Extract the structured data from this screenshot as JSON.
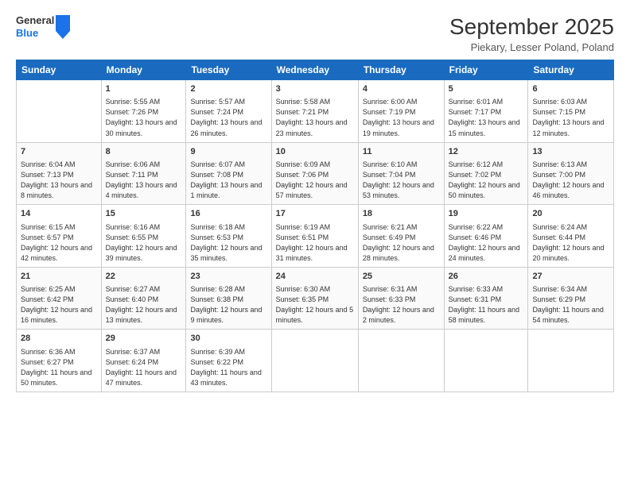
{
  "logo": {
    "general": "General",
    "blue": "Blue"
  },
  "title": "September 2025",
  "location": "Piekary, Lesser Poland, Poland",
  "days_of_week": [
    "Sunday",
    "Monday",
    "Tuesday",
    "Wednesday",
    "Thursday",
    "Friday",
    "Saturday"
  ],
  "weeks": [
    [
      {
        "day": "",
        "sunrise": "",
        "sunset": "",
        "daylight": ""
      },
      {
        "day": "1",
        "sunrise": "Sunrise: 5:55 AM",
        "sunset": "Sunset: 7:26 PM",
        "daylight": "Daylight: 13 hours and 30 minutes."
      },
      {
        "day": "2",
        "sunrise": "Sunrise: 5:57 AM",
        "sunset": "Sunset: 7:24 PM",
        "daylight": "Daylight: 13 hours and 26 minutes."
      },
      {
        "day": "3",
        "sunrise": "Sunrise: 5:58 AM",
        "sunset": "Sunset: 7:21 PM",
        "daylight": "Daylight: 13 hours and 23 minutes."
      },
      {
        "day": "4",
        "sunrise": "Sunrise: 6:00 AM",
        "sunset": "Sunset: 7:19 PM",
        "daylight": "Daylight: 13 hours and 19 minutes."
      },
      {
        "day": "5",
        "sunrise": "Sunrise: 6:01 AM",
        "sunset": "Sunset: 7:17 PM",
        "daylight": "Daylight: 13 hours and 15 minutes."
      },
      {
        "day": "6",
        "sunrise": "Sunrise: 6:03 AM",
        "sunset": "Sunset: 7:15 PM",
        "daylight": "Daylight: 13 hours and 12 minutes."
      }
    ],
    [
      {
        "day": "7",
        "sunrise": "Sunrise: 6:04 AM",
        "sunset": "Sunset: 7:13 PM",
        "daylight": "Daylight: 13 hours and 8 minutes."
      },
      {
        "day": "8",
        "sunrise": "Sunrise: 6:06 AM",
        "sunset": "Sunset: 7:11 PM",
        "daylight": "Daylight: 13 hours and 4 minutes."
      },
      {
        "day": "9",
        "sunrise": "Sunrise: 6:07 AM",
        "sunset": "Sunset: 7:08 PM",
        "daylight": "Daylight: 13 hours and 1 minute."
      },
      {
        "day": "10",
        "sunrise": "Sunrise: 6:09 AM",
        "sunset": "Sunset: 7:06 PM",
        "daylight": "Daylight: 12 hours and 57 minutes."
      },
      {
        "day": "11",
        "sunrise": "Sunrise: 6:10 AM",
        "sunset": "Sunset: 7:04 PM",
        "daylight": "Daylight: 12 hours and 53 minutes."
      },
      {
        "day": "12",
        "sunrise": "Sunrise: 6:12 AM",
        "sunset": "Sunset: 7:02 PM",
        "daylight": "Daylight: 12 hours and 50 minutes."
      },
      {
        "day": "13",
        "sunrise": "Sunrise: 6:13 AM",
        "sunset": "Sunset: 7:00 PM",
        "daylight": "Daylight: 12 hours and 46 minutes."
      }
    ],
    [
      {
        "day": "14",
        "sunrise": "Sunrise: 6:15 AM",
        "sunset": "Sunset: 6:57 PM",
        "daylight": "Daylight: 12 hours and 42 minutes."
      },
      {
        "day": "15",
        "sunrise": "Sunrise: 6:16 AM",
        "sunset": "Sunset: 6:55 PM",
        "daylight": "Daylight: 12 hours and 39 minutes."
      },
      {
        "day": "16",
        "sunrise": "Sunrise: 6:18 AM",
        "sunset": "Sunset: 6:53 PM",
        "daylight": "Daylight: 12 hours and 35 minutes."
      },
      {
        "day": "17",
        "sunrise": "Sunrise: 6:19 AM",
        "sunset": "Sunset: 6:51 PM",
        "daylight": "Daylight: 12 hours and 31 minutes."
      },
      {
        "day": "18",
        "sunrise": "Sunrise: 6:21 AM",
        "sunset": "Sunset: 6:49 PM",
        "daylight": "Daylight: 12 hours and 28 minutes."
      },
      {
        "day": "19",
        "sunrise": "Sunrise: 6:22 AM",
        "sunset": "Sunset: 6:46 PM",
        "daylight": "Daylight: 12 hours and 24 minutes."
      },
      {
        "day": "20",
        "sunrise": "Sunrise: 6:24 AM",
        "sunset": "Sunset: 6:44 PM",
        "daylight": "Daylight: 12 hours and 20 minutes."
      }
    ],
    [
      {
        "day": "21",
        "sunrise": "Sunrise: 6:25 AM",
        "sunset": "Sunset: 6:42 PM",
        "daylight": "Daylight: 12 hours and 16 minutes."
      },
      {
        "day": "22",
        "sunrise": "Sunrise: 6:27 AM",
        "sunset": "Sunset: 6:40 PM",
        "daylight": "Daylight: 12 hours and 13 minutes."
      },
      {
        "day": "23",
        "sunrise": "Sunrise: 6:28 AM",
        "sunset": "Sunset: 6:38 PM",
        "daylight": "Daylight: 12 hours and 9 minutes."
      },
      {
        "day": "24",
        "sunrise": "Sunrise: 6:30 AM",
        "sunset": "Sunset: 6:35 PM",
        "daylight": "Daylight: 12 hours and 5 minutes."
      },
      {
        "day": "25",
        "sunrise": "Sunrise: 6:31 AM",
        "sunset": "Sunset: 6:33 PM",
        "daylight": "Daylight: 12 hours and 2 minutes."
      },
      {
        "day": "26",
        "sunrise": "Sunrise: 6:33 AM",
        "sunset": "Sunset: 6:31 PM",
        "daylight": "Daylight: 11 hours and 58 minutes."
      },
      {
        "day": "27",
        "sunrise": "Sunrise: 6:34 AM",
        "sunset": "Sunset: 6:29 PM",
        "daylight": "Daylight: 11 hours and 54 minutes."
      }
    ],
    [
      {
        "day": "28",
        "sunrise": "Sunrise: 6:36 AM",
        "sunset": "Sunset: 6:27 PM",
        "daylight": "Daylight: 11 hours and 50 minutes."
      },
      {
        "day": "29",
        "sunrise": "Sunrise: 6:37 AM",
        "sunset": "Sunset: 6:24 PM",
        "daylight": "Daylight: 11 hours and 47 minutes."
      },
      {
        "day": "30",
        "sunrise": "Sunrise: 6:39 AM",
        "sunset": "Sunset: 6:22 PM",
        "daylight": "Daylight: 11 hours and 43 minutes."
      },
      {
        "day": "",
        "sunrise": "",
        "sunset": "",
        "daylight": ""
      },
      {
        "day": "",
        "sunrise": "",
        "sunset": "",
        "daylight": ""
      },
      {
        "day": "",
        "sunrise": "",
        "sunset": "",
        "daylight": ""
      },
      {
        "day": "",
        "sunrise": "",
        "sunset": "",
        "daylight": ""
      }
    ]
  ]
}
